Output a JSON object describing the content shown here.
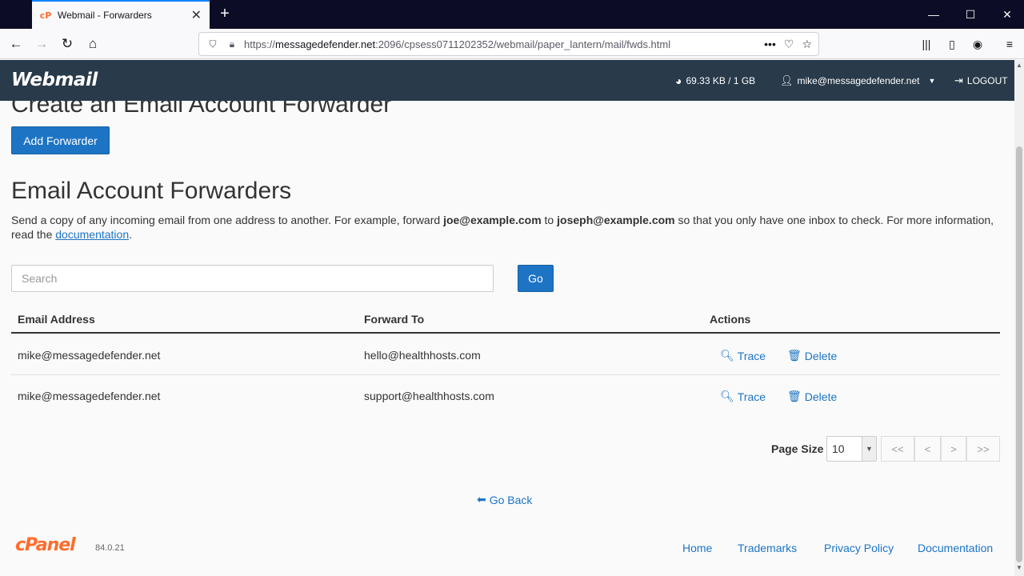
{
  "browser": {
    "tab_title": "Webmail - Forwarders",
    "tab_favicon": "cP",
    "new_tab": "+",
    "url_prefix": "https://",
    "url_host": "messagedefender.net",
    "url_path": ":2096/cpsess0711202352/webmail/paper_lantern/mail/fwds.html"
  },
  "header": {
    "logo": "Webmail",
    "disk_usage": "69.33 KB / 1 GB",
    "user": "mike@messagedefender.net",
    "logout": "LOGOUT"
  },
  "create_section": {
    "title": "Create an Email Account Forwarder",
    "add_button": "Add Forwarder"
  },
  "forwarders_section": {
    "title": "Email Account Forwarders",
    "desc_part1": "Send a copy of any incoming email from one address to another. For example, forward ",
    "desc_example_from": "joe@example.com",
    "desc_part2": " to ",
    "desc_example_to": "joseph@example.com",
    "desc_part3": " so that you only have one inbox to check. For more information, read the ",
    "desc_link": "documentation",
    "desc_part4": "."
  },
  "search": {
    "placeholder": "Search",
    "go_button": "Go"
  },
  "table": {
    "headers": {
      "email": "Email Address",
      "forward_to": "Forward To",
      "actions": "Actions"
    },
    "rows": [
      {
        "email": "mike@messagedefender.net",
        "forward_to": "hello@healthhosts.com",
        "trace": "Trace",
        "delete": "Delete"
      },
      {
        "email": "mike@messagedefender.net",
        "forward_to": "support@healthhosts.com",
        "trace": "Trace",
        "delete": "Delete"
      }
    ]
  },
  "pagination": {
    "page_size_label": "Page Size",
    "page_size_value": "10",
    "first": "<<",
    "prev": "<",
    "next": ">",
    "last": ">>"
  },
  "go_back": "Go Back",
  "footer": {
    "logo": "cPanel",
    "version": "84.0.21",
    "links": [
      "Home",
      "Trademarks",
      "Privacy Policy",
      "Documentation"
    ]
  },
  "colors": {
    "header_bg": "#293a4a",
    "primary": "#1d74c4",
    "cpanel_orange": "#ff6c2c"
  }
}
